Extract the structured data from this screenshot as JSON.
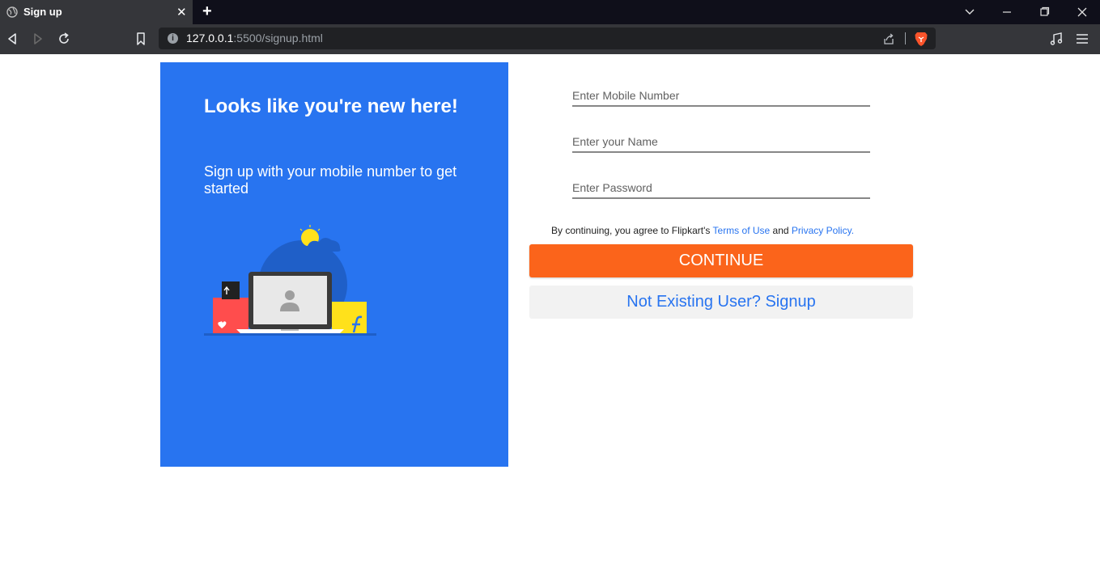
{
  "browser": {
    "tab_title": "Sign up",
    "tab_close": "✕",
    "new_tab": "+",
    "url_host": "127.0.0.1",
    "url_rest": ":5500/signup.html",
    "url_info_glyph": "i"
  },
  "left_panel": {
    "title": "Looks like you're new here!",
    "subtitle": "Sign up with your mobile number to get started",
    "color": "#2874f0"
  },
  "form": {
    "mobile_placeholder": "Enter Mobile Number",
    "name_placeholder": "Enter your Name",
    "password_placeholder": "Enter Password",
    "terms_prefix": "By continuing, you agree to Flipkart's ",
    "terms_link": "Terms of Use",
    "terms_and": " and ",
    "privacy_link": "Privacy Policy.",
    "continue_label": "CONTINUE",
    "signup_label": "Not Existing User? Signup"
  },
  "colors": {
    "accent_orange": "#fb641b",
    "link_blue": "#2874f0"
  },
  "icons": [
    "globe-icon",
    "close-icon",
    "plus-icon",
    "chevron-down-icon",
    "minimize-icon",
    "restore-icon",
    "window-close-icon",
    "back-icon",
    "forward-icon",
    "reload-icon",
    "bookmark-icon",
    "info-icon",
    "share-icon",
    "brave-lion-icon",
    "music-icon",
    "menu-icon"
  ]
}
